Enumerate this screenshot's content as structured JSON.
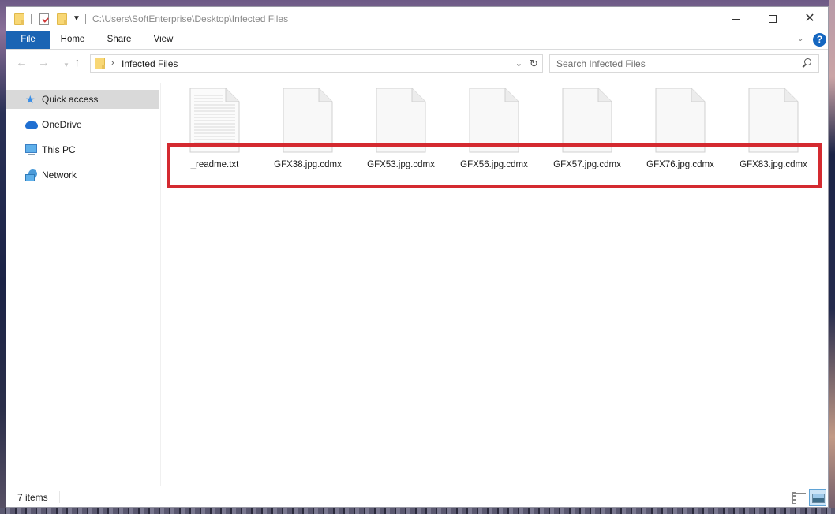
{
  "titlebar": {
    "path": "C:\\Users\\SoftEnterprise\\Desktop\\Infected Files",
    "quick_access_icons": [
      "folder-icon",
      "properties-icon",
      "new-folder-icon",
      "customize-dropdown-icon"
    ],
    "minimize_glyph": "—",
    "maximize_glyph": "☐",
    "close_glyph": "✕"
  },
  "ribbon": {
    "tabs": [
      {
        "label": "File",
        "active": true
      },
      {
        "label": "Home"
      },
      {
        "label": "Share"
      },
      {
        "label": "View"
      }
    ],
    "expand_glyph": "⌄",
    "help_glyph": "?",
    "accent_color": "#1a64b4"
  },
  "navbar": {
    "back_glyph": "←",
    "forward_glyph": "→",
    "recent_glyph": "⌄",
    "up_glyph": "↑",
    "breadcrumb_chevron": "›",
    "current_folder": "Infected Files",
    "address_dropdown_glyph": "⌄",
    "refresh_glyph": "↻",
    "search_placeholder": "Search Infected Files"
  },
  "navpane": {
    "items": [
      {
        "label": "Quick access",
        "icon": "star-icon",
        "selected": true
      },
      {
        "label": "OneDrive",
        "icon": "cloud-icon"
      },
      {
        "label": "This PC",
        "icon": "computer-icon"
      },
      {
        "label": "Network",
        "icon": "network-icon"
      }
    ]
  },
  "files": [
    {
      "name": "_readme.txt",
      "type": "text"
    },
    {
      "name": "GFX38.jpg.cdmx",
      "type": "blank"
    },
    {
      "name": "GFX53.jpg.cdmx",
      "type": "blank"
    },
    {
      "name": "GFX56.jpg.cdmx",
      "type": "blank"
    },
    {
      "name": "GFX57.jpg.cdmx",
      "type": "blank"
    },
    {
      "name": "GFX76.jpg.cdmx",
      "type": "blank"
    },
    {
      "name": "GFX83.jpg.cdmx",
      "type": "blank"
    }
  ],
  "highlight_color": "#d42a30",
  "statusbar": {
    "item_count": "7 items"
  }
}
